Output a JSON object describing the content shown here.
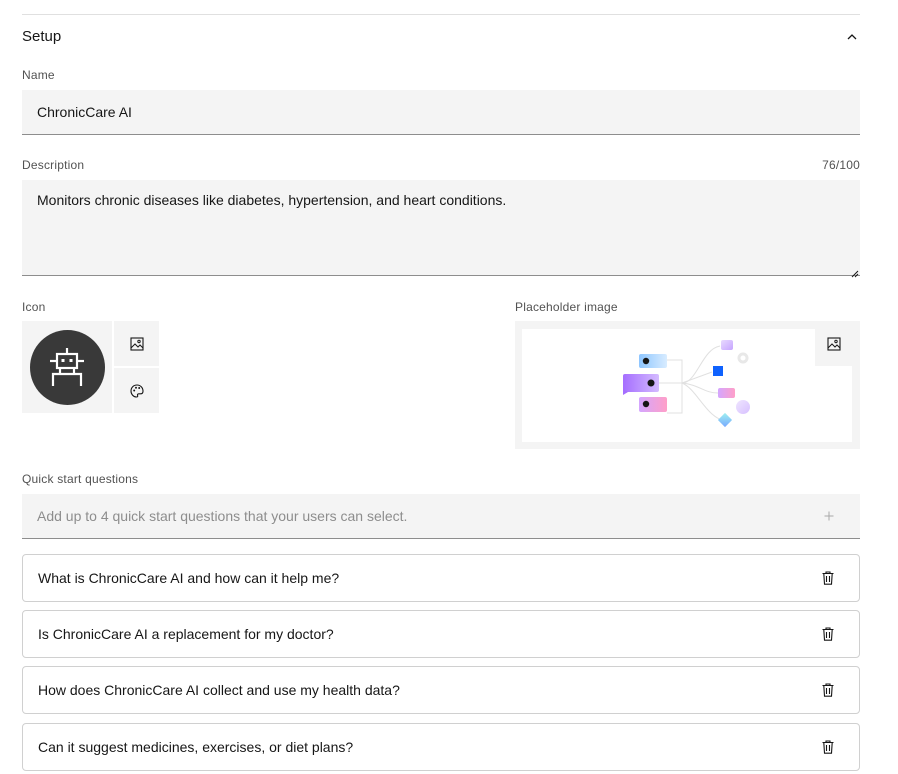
{
  "section": {
    "title": "Setup",
    "collapse_icon": "chevron-up-icon"
  },
  "name_field": {
    "label": "Name",
    "value": "ChronicCare AI"
  },
  "description_field": {
    "label": "Description",
    "counter": "76/100",
    "value": "Monitors chronic diseases like diabetes, hypertension, and heart conditions."
  },
  "icon_field": {
    "label": "Icon",
    "avatar_icon": "robot-icon",
    "upload_icon": "image-icon",
    "palette_icon": "palette-icon"
  },
  "placeholder_field": {
    "label": "Placeholder image",
    "upload_icon": "image-icon"
  },
  "quick_start": {
    "label": "Quick start questions",
    "placeholder": "Add up to 4 quick start questions that your users can select.",
    "add_icon": "plus-icon",
    "questions": [
      "What is ChronicCare AI and how can it help me?",
      "Is ChronicCare AI a replacement for my doctor?",
      "How does ChronicCare AI collect and use my health data?",
      "Can it suggest medicines, exercises, or diet plans?"
    ],
    "delete_icon": "trash-icon"
  },
  "colors": {
    "field_bg": "#f4f4f4",
    "avatar_bg": "#393939",
    "accent_blue": "#0f62fe",
    "accent_purple": "#a56eff"
  }
}
